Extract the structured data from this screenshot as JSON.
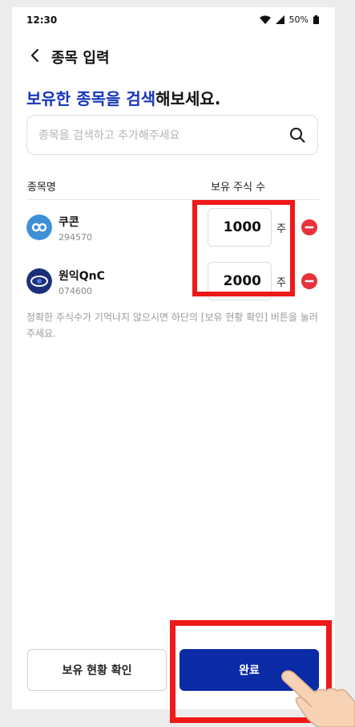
{
  "status_bar": {
    "time": "12:30",
    "battery": "50%"
  },
  "header": {
    "title": "종목 입력"
  },
  "headline": {
    "accent": "보유한 종목을 검색",
    "rest": "해보세요."
  },
  "search": {
    "placeholder": "종목을 검색하고 추가해주세요"
  },
  "table": {
    "col_name": "종목명",
    "col_shares": "보유 주식 수"
  },
  "stocks": [
    {
      "name": "쿠콘",
      "code": "294570",
      "quantity": "1000",
      "unit": "주"
    },
    {
      "name": "원익QnC",
      "code": "074600",
      "quantity": "2000",
      "unit": "주"
    }
  ],
  "helper_text": "정확한 주식수가 기억나지 않으시면 하단의 [보유 현황 확인] 버튼을 눌러주세요.",
  "buttons": {
    "check_holdings": "보유 현황 확인",
    "done": "완료"
  },
  "colors": {
    "accent": "#1536b8",
    "primary_button": "#0a2aa6",
    "remove": "#e8323b",
    "highlight": "#f01818"
  },
  "icons": {
    "back": "chevron-left-icon",
    "search": "search-icon",
    "remove": "minus-circle-icon"
  }
}
